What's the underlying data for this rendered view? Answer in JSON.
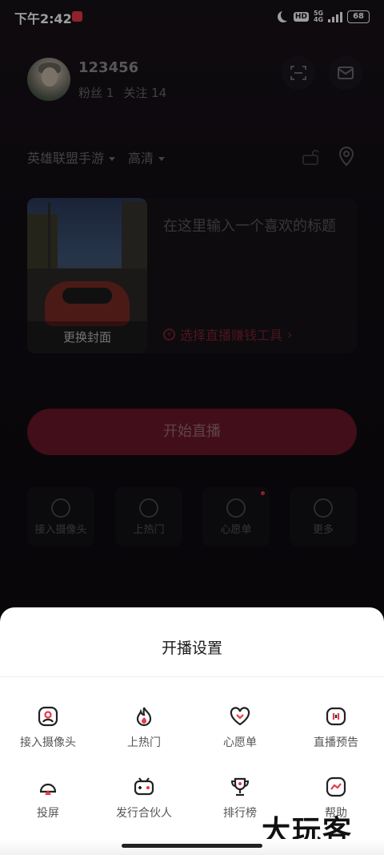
{
  "status_bar": {
    "time": "下午2:42",
    "network": "5G",
    "battery": "68"
  },
  "profile": {
    "username": "123456",
    "fans_label": "粉丝",
    "fans_count": "1",
    "follow_label": "关注",
    "follow_count": "14"
  },
  "stream_setup": {
    "category": "英雄联盟手游",
    "quality": "高清",
    "cover_label": "更换封面",
    "title_placeholder": "在这里输入一个喜欢的标题",
    "money_tool": "选择直播赚钱工具",
    "start_button": "开始直播"
  },
  "quick_actions": [
    {
      "label": "接入摄像头",
      "icon": "camera-icon"
    },
    {
      "label": "上热门",
      "icon": "flame-icon"
    },
    {
      "label": "心愿单",
      "icon": "heart-icon"
    },
    {
      "label": "更多",
      "icon": "more-icon"
    }
  ],
  "sheet": {
    "title": "开播设置",
    "options": [
      {
        "label": "接入摄像头",
        "icon": "camera-icon"
      },
      {
        "label": "上热门",
        "icon": "flame-icon"
      },
      {
        "label": "心愿单",
        "icon": "heart-icon"
      },
      {
        "label": "直播预告",
        "icon": "preview-icon"
      },
      {
        "label": "投屏",
        "icon": "cast-icon"
      },
      {
        "label": "发行合伙人",
        "icon": "gamepad-icon"
      },
      {
        "label": "排行榜",
        "icon": "trophy-icon"
      },
      {
        "label": "帮助",
        "icon": "help-icon"
      }
    ]
  },
  "watermark": "大玩客",
  "colors": {
    "accent": "#e8374a",
    "start_button": "#6a1829",
    "sheet_bg": "#ffffff"
  }
}
